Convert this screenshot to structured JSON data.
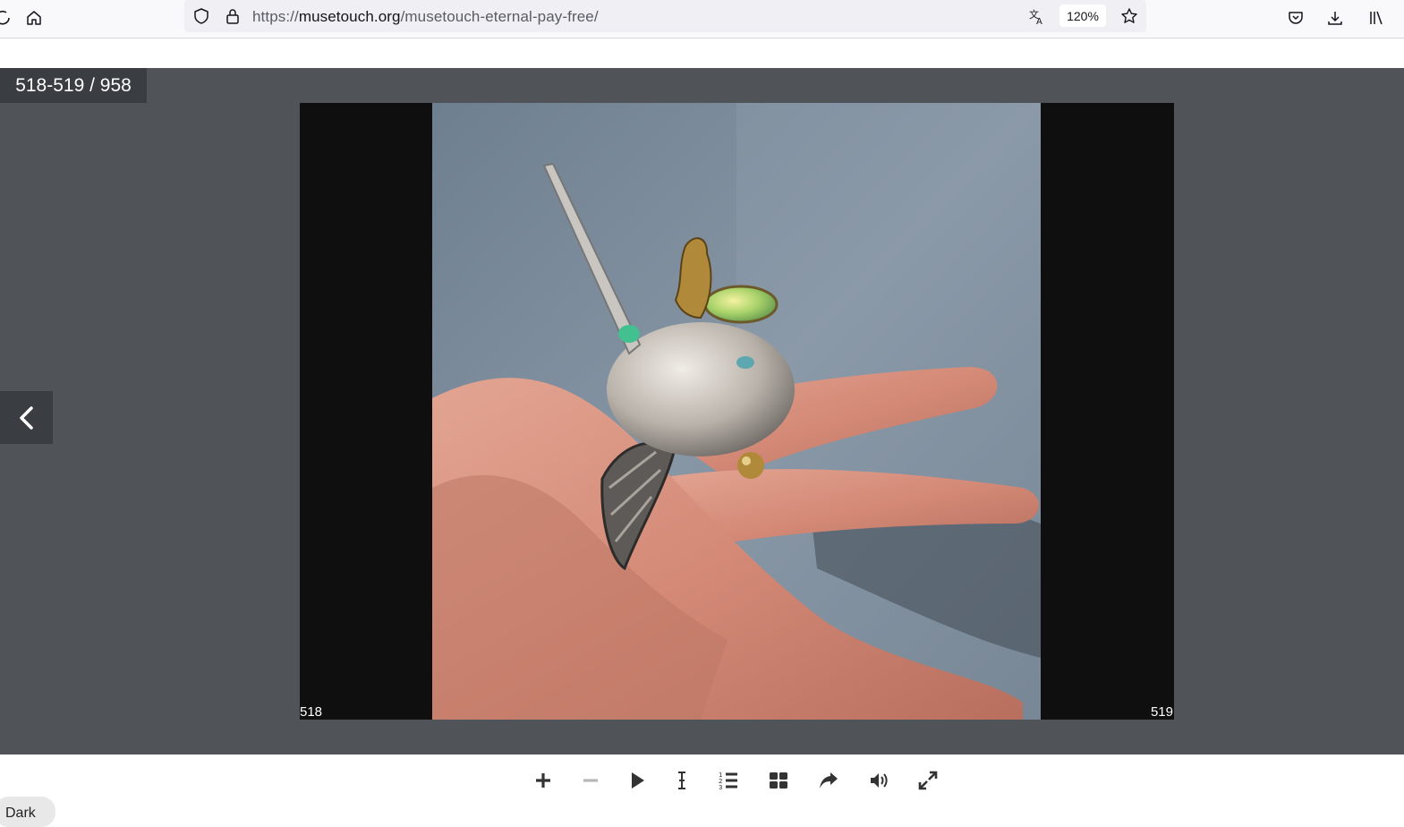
{
  "browser": {
    "url_prefix": "https://",
    "url_domain": "musetouch.org",
    "url_path": "/musetouch-eternal-pay-free/",
    "zoom": "120%"
  },
  "viewer": {
    "page_counter": "518-519 / 958",
    "left_page_number": "518",
    "right_page_number": "519",
    "image_description_icon": "ring-photo"
  },
  "toolbar": {
    "tools": [
      "zoom-in",
      "zoom-out",
      "play",
      "text-select",
      "table-of-contents",
      "thumbnails",
      "share",
      "sound",
      "fullscreen"
    ]
  },
  "theme_toggle": {
    "label": "Dark"
  },
  "colors": {
    "viewer_bg": "#505459",
    "counter_bg": "#3a3d41",
    "book_bg": "#0f0f0f"
  }
}
